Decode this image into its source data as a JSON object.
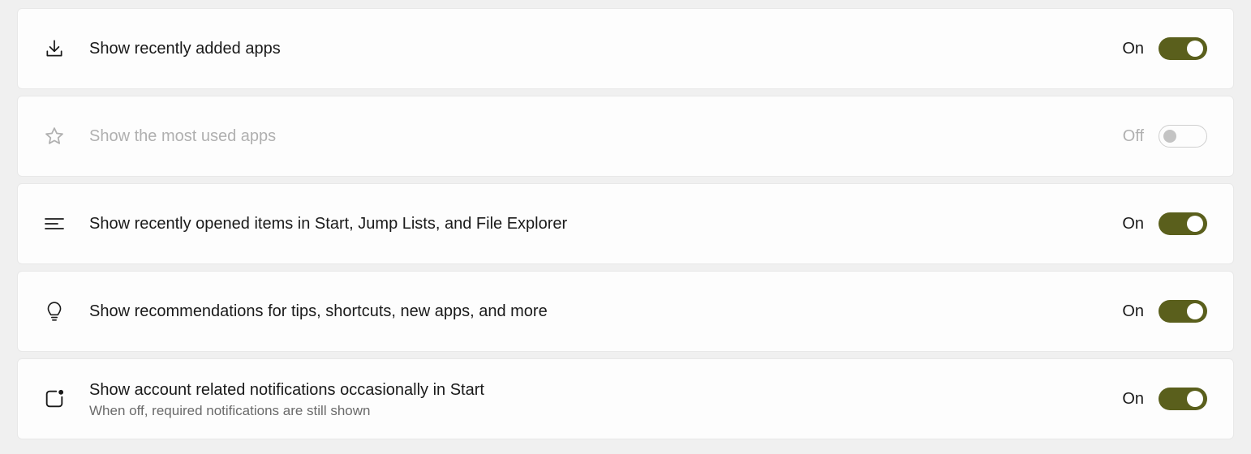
{
  "colors": {
    "accent_toggle_on": "#5a5f1c"
  },
  "settings": {
    "recently_added": {
      "label": "Show recently added apps",
      "state_label": "On",
      "on": true,
      "disabled": false,
      "icon": "download-icon"
    },
    "most_used": {
      "label": "Show the most used apps",
      "state_label": "Off",
      "on": false,
      "disabled": true,
      "icon": "star-icon"
    },
    "recent_items": {
      "label": "Show recently opened items in Start, Jump Lists, and File Explorer",
      "state_label": "On",
      "on": true,
      "disabled": false,
      "icon": "list-icon"
    },
    "recommendations": {
      "label": "Show recommendations for tips, shortcuts, new apps, and more",
      "state_label": "On",
      "on": true,
      "disabled": false,
      "icon": "lightbulb-icon"
    },
    "account_notifications": {
      "label": "Show account related notifications occasionally in Start",
      "description": "When off, required notifications are still shown",
      "state_label": "On",
      "on": true,
      "disabled": false,
      "icon": "square-dot-icon"
    }
  }
}
